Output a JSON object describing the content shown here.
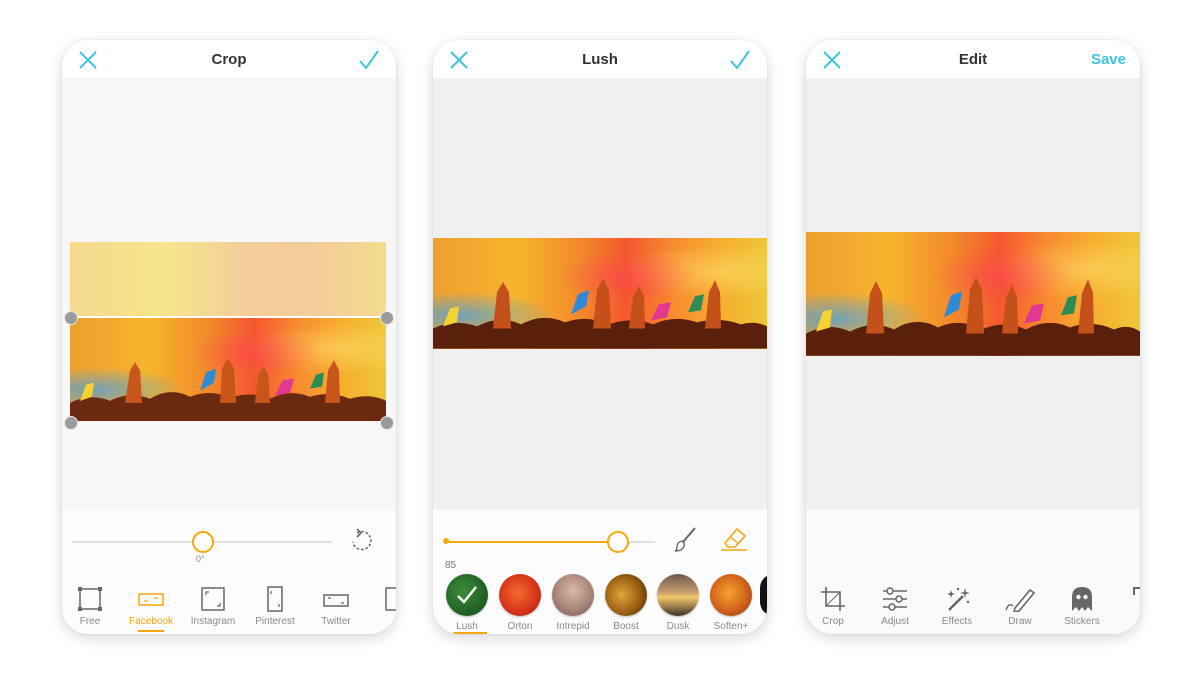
{
  "screens": {
    "crop": {
      "title": "Crop",
      "rotation_label": "0°",
      "tools": [
        {
          "label": "Free"
        },
        {
          "label": "Facebook"
        },
        {
          "label": "Instagram"
        },
        {
          "label": "Pinterest"
        },
        {
          "label": "Twitter"
        }
      ],
      "active_tool": "Facebook"
    },
    "lush": {
      "title": "Lush",
      "intensity": "85",
      "filters": [
        {
          "label": "Lush"
        },
        {
          "label": "Orton"
        },
        {
          "label": "Intrepid"
        },
        {
          "label": "Boost"
        },
        {
          "label": "Dusk"
        },
        {
          "label": "Soften+"
        }
      ],
      "active_filter": "Lush"
    },
    "edit": {
      "title": "Edit",
      "save_label": "Save",
      "tools": [
        {
          "label": "Crop"
        },
        {
          "label": "Adjust"
        },
        {
          "label": "Effects"
        },
        {
          "label": "Draw"
        },
        {
          "label": "Stickers"
        }
      ]
    }
  },
  "colors": {
    "accent_blue": "#3ec3de",
    "accent_orange": "#f5a70b",
    "title_text": "#333333",
    "label_text": "#8a8a8a"
  },
  "icons": [
    "close-icon",
    "checkmark-icon",
    "rotate-icon",
    "brush-icon",
    "eraser-icon",
    "crop-icon",
    "sliders-icon",
    "magic-wand-icon",
    "pencil-icon",
    "ghost-icon"
  ]
}
